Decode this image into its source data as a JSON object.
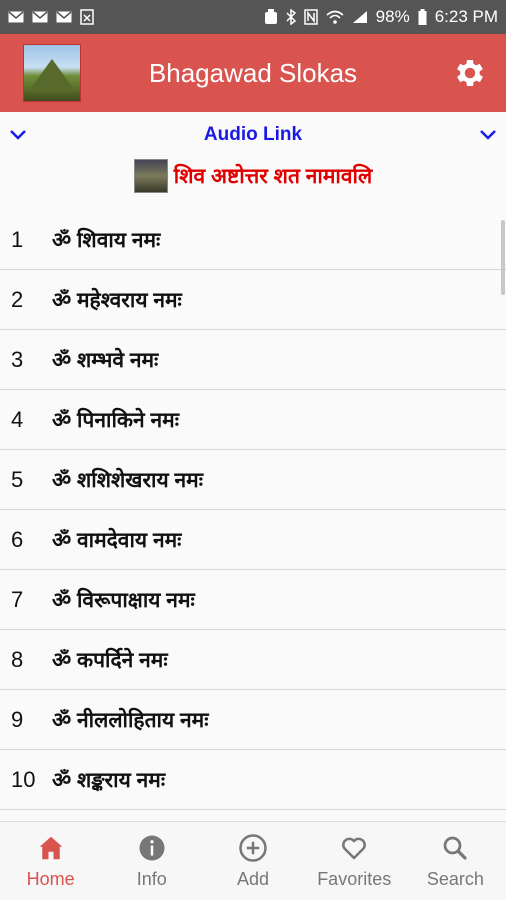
{
  "status_bar": {
    "battery": "98%",
    "time": "6:23 PM"
  },
  "app_bar": {
    "title": "Bhagawad Slokas"
  },
  "audio": {
    "label": "Audio Link"
  },
  "section": {
    "title": "शिव अष्टोत्तर शत नामावलि"
  },
  "items": [
    {
      "num": "1",
      "text": "ॐ शिवाय नमः"
    },
    {
      "num": "2",
      "text": "ॐ महेश्वराय नमः"
    },
    {
      "num": "3",
      "text": "ॐ शम्भवे नमः"
    },
    {
      "num": "4",
      "text": "ॐ पिनाकिने नमः"
    },
    {
      "num": "5",
      "text": "ॐ शशिशेखराय नमः"
    },
    {
      "num": "6",
      "text": "ॐ वामदेवाय नमः"
    },
    {
      "num": "7",
      "text": "ॐ विरूपाक्षाय नमः"
    },
    {
      "num": "8",
      "text": "ॐ कपर्दिने नमः"
    },
    {
      "num": "9",
      "text": "ॐ नीललोहिताय नमः"
    },
    {
      "num": "10",
      "text": "ॐ शङ्कराय नमः"
    }
  ],
  "nav": [
    {
      "label": "Home",
      "icon": "home-icon",
      "active": true
    },
    {
      "label": "Info",
      "icon": "info-icon",
      "active": false
    },
    {
      "label": "Add",
      "icon": "add-icon",
      "active": false
    },
    {
      "label": "Favorites",
      "icon": "heart-icon",
      "active": false
    },
    {
      "label": "Search",
      "icon": "search-icon",
      "active": false
    }
  ],
  "colors": {
    "accent": "#d9534f",
    "audio_link": "#1a1ae6",
    "section_title": "#e00000"
  }
}
